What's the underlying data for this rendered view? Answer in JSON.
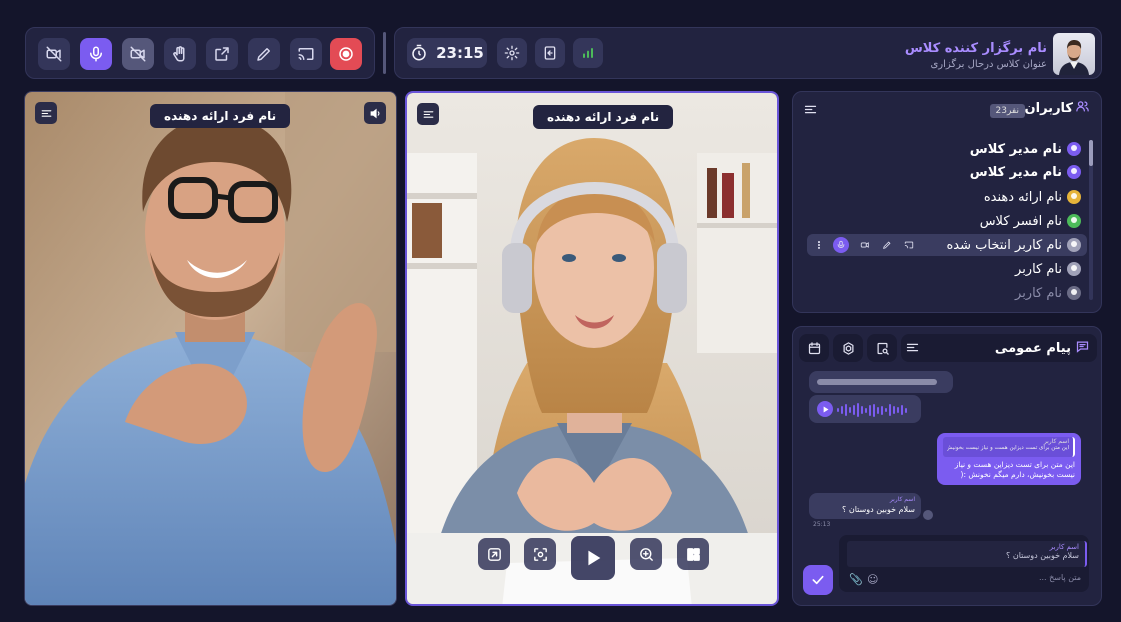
{
  "toolbar": {
    "buttons": [
      "camera-off",
      "mic",
      "video-off",
      "raise-hand",
      "share-screen",
      "draw",
      "cast",
      "record"
    ]
  },
  "header": {
    "timer": "23:15",
    "host_name": "نام برگزار کننده کلاس",
    "class_status": "عنوان کلاس درحال برگزاری"
  },
  "videos": [
    {
      "presenter_label": "نام فرد ارائه دهنده"
    },
    {
      "presenter_label": "نام فرد ارائه دهنده"
    }
  ],
  "users": {
    "title": "کاربران",
    "count": "23نفر",
    "items": [
      {
        "name": "نام مدیر کلاس",
        "color": "#7b5cf0",
        "bold": true
      },
      {
        "name": "نام مدیر کلاس",
        "color": "#7b5cf0",
        "bold": true
      },
      {
        "name": "نام ارائه دهنده",
        "color": "#e6b43a",
        "bold": false
      },
      {
        "name": "نام افسر کلاس",
        "color": "#4cbb5a",
        "bold": false
      },
      {
        "name": "نام کاربر انتخاب شده",
        "color": "#a0a1b8",
        "bold": false
      },
      {
        "name": "نام کاربر",
        "color": "#a0a1b8",
        "bold": false
      },
      {
        "name": "نام کاربر",
        "color": "#6b6c86",
        "bold": false
      }
    ]
  },
  "chat": {
    "title": "پیام عمومی",
    "reply_quote_name": "اسم کاربر",
    "reply_quote_text": "این متن برای تست دیزاین هست و نیاز نیست بخونیش دارم",
    "own_message": "این متن برای تست دیزاین هست و نیاز نیست بخونیش، دارم میگم نخونش :(",
    "incoming_name": "اسم کاربر",
    "incoming_message": "سلام خوبین دوستان ؟",
    "incoming_time": "25:13",
    "draft_reply_name": "اسم کاربر",
    "draft_reply_text": "سلام خوبین دوستان ؟",
    "input_placeholder": "متن پاسخ ..."
  },
  "colors": {
    "background": "#14152b",
    "panel": "#222340",
    "accent": "#7b5cf0",
    "record": "#e34b55"
  }
}
